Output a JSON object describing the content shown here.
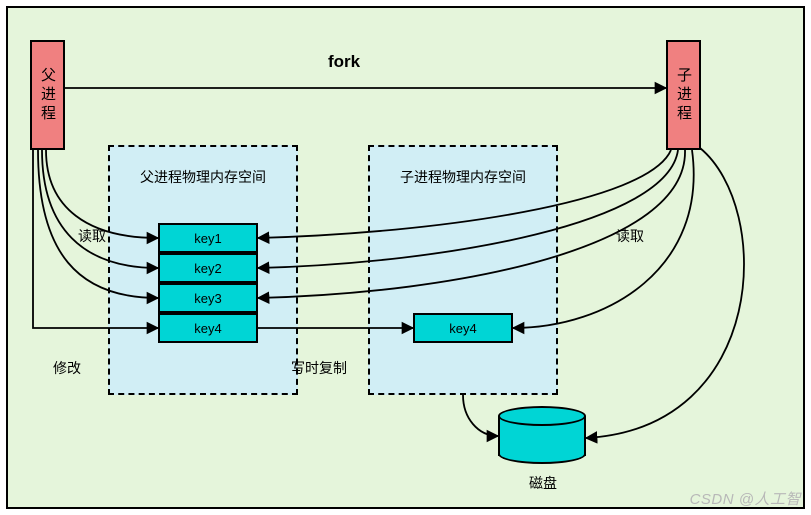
{
  "diagram": {
    "parent_process": "父进程",
    "child_process": "子进程",
    "fork_label": "fork",
    "parent_mem": {
      "title": "父进程物理内存空间",
      "keys": [
        "key1",
        "key2",
        "key3",
        "key4"
      ]
    },
    "child_mem": {
      "title": "子进程物理内存空间",
      "copied_key": "key4"
    },
    "labels": {
      "read_left": "读取",
      "read_right": "读取",
      "modify": "修改",
      "copy_on_write": "写时复制"
    },
    "disk": "磁盘",
    "watermark": "CSDN @人工智",
    "colors": {
      "bg": "#e5f5db",
      "proc": "#f08080",
      "mem_bg": "#d1eef5",
      "key_bg": "#00d5d5"
    }
  }
}
